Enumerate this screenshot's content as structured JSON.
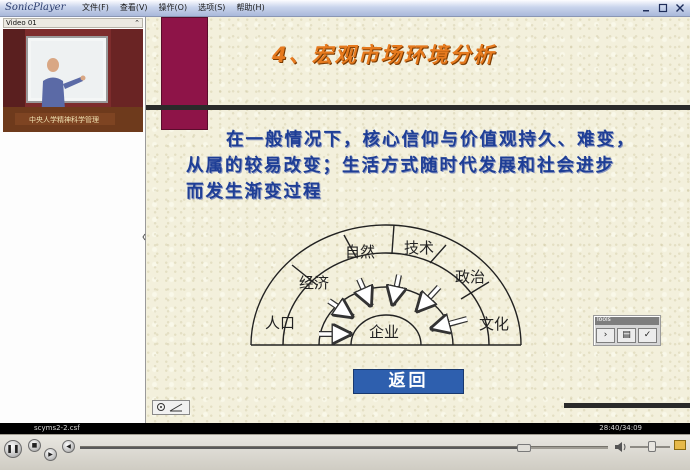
{
  "app": {
    "title": "SonicPlayer",
    "menu": [
      "文件(F)",
      "查看(V)",
      "操作(O)",
      "选项(S)",
      "帮助(H)"
    ],
    "window_controls": [
      "minimize-icon",
      "maximize-icon",
      "close-icon"
    ]
  },
  "video": {
    "header": "Video 01",
    "menu_icon": "pin-icon",
    "caption": "中央人学精神科学管理"
  },
  "slide": {
    "title": "4、宏观市场环境分析",
    "body_lines": [
      "在一般情况下，核心信仰与价值观持久、难变，",
      "从属的较易改变；生活方式随时代发展和社会进步",
      "而发生渐变过程"
    ],
    "diagram": {
      "outer_labels": [
        "人口",
        "经济",
        "自然",
        "技术",
        "政治",
        "文化"
      ],
      "center_label": "企业"
    },
    "return_button": "返回",
    "tools_title": "Tools",
    "tools_buttons": [
      "›",
      "▤",
      "✓"
    ]
  },
  "status": {
    "filename": "scyms2-2.csf",
    "time": "28:40/34:09"
  },
  "player": {
    "progress_fraction": 0.84,
    "volume_fraction": 0.55,
    "icons": [
      "pause-icon",
      "stop-icon",
      "next-icon",
      "prev-icon",
      "volume-icon",
      "folder-icon"
    ]
  },
  "colors": {
    "title_orange": "#e67a1e",
    "body_blue": "#1e3e96",
    "maroon": "#8e1448",
    "button_blue": "#2e5fae"
  }
}
